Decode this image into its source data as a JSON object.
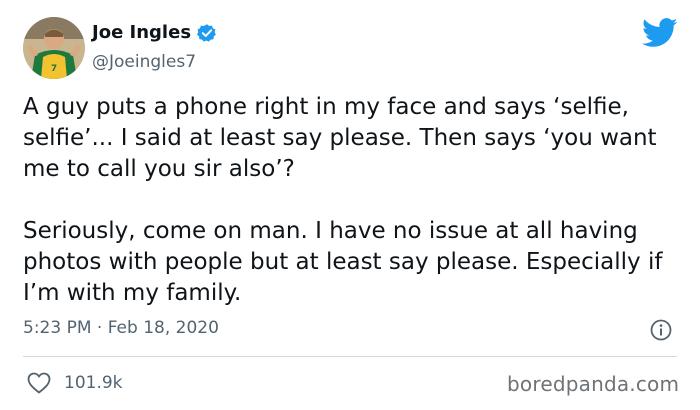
{
  "author": {
    "display_name": "Joe Ingles",
    "handle": "@Joeingles7",
    "verified": true
  },
  "tweet": {
    "paragraphs": [
      "A guy puts a phone right in my face and says ‘selfie, selfie’... I said at least say please. Then says ‘you want me to call you sir also’?",
      "Seriously, come on man. I have no issue at all having photos with people but at least say please. Especially if I’m with my family."
    ],
    "timestamp": "5:23 PM · Feb 18, 2020"
  },
  "engagement": {
    "likes": "101.9k"
  },
  "watermark": "boredpanda.com",
  "colors": {
    "twitter_blue": "#1d9bf0",
    "text": "#0f1419",
    "secondary": "#536471",
    "jersey_green": "#1e7a3c",
    "jersey_gold": "#f2c230"
  },
  "icons": {
    "logo": "twitter-bird-icon",
    "verified": "verified-badge-icon",
    "info": "info-icon",
    "like": "heart-icon"
  }
}
